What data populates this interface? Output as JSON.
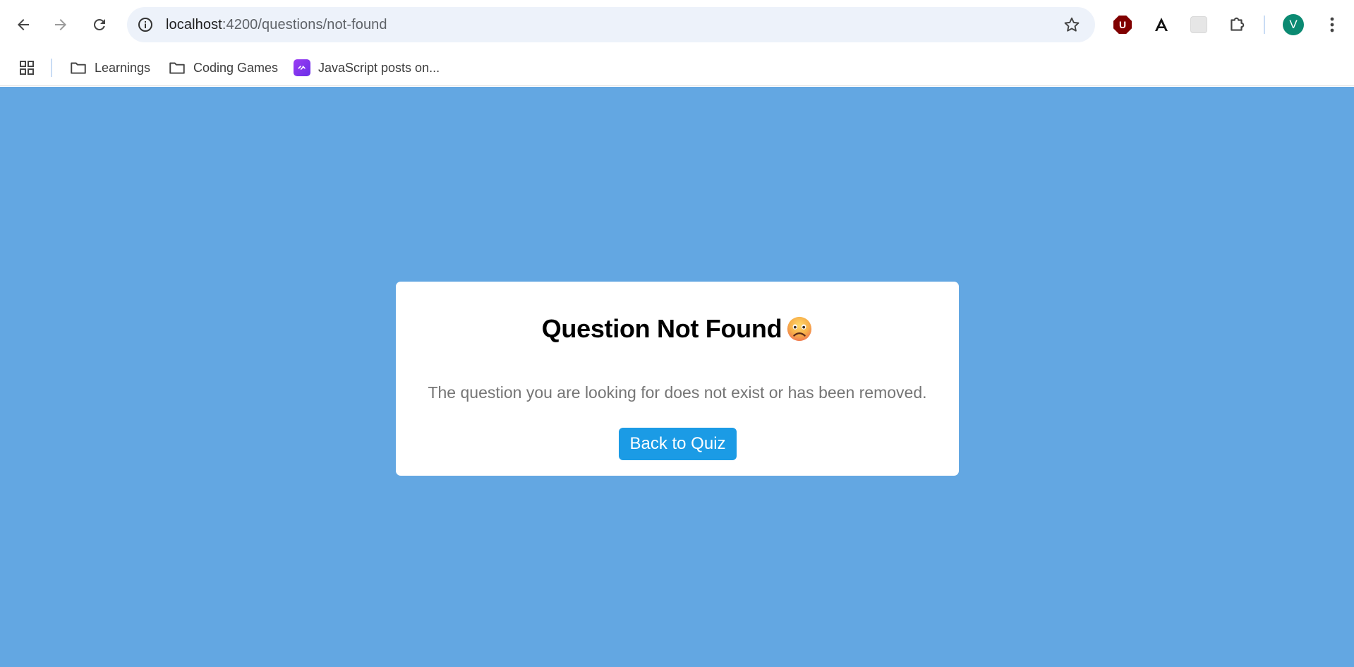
{
  "browser": {
    "url_host": "localhost",
    "url_rest": ":4200/questions/not-found",
    "avatar_letter": "V",
    "ublock_letter": "U"
  },
  "bookmarks": [
    {
      "label": "Learnings",
      "icon": "folder-icon"
    },
    {
      "label": "Coding Games",
      "icon": "folder-icon"
    },
    {
      "label": "JavaScript posts on...",
      "icon": "js-posts-favicon"
    }
  ],
  "card": {
    "title": "Question Not Found",
    "emoji": "frowning-face-emoji",
    "message": "The question you are looking for does not exist or has been removed.",
    "button_label": "Back to Quiz"
  },
  "colors": {
    "page_background": "#63a7e2",
    "card_background": "#ffffff",
    "button_background": "#1b9be5",
    "button_text": "#ffffff",
    "message_text": "#757575",
    "omnibox_background": "#edf2fa"
  }
}
